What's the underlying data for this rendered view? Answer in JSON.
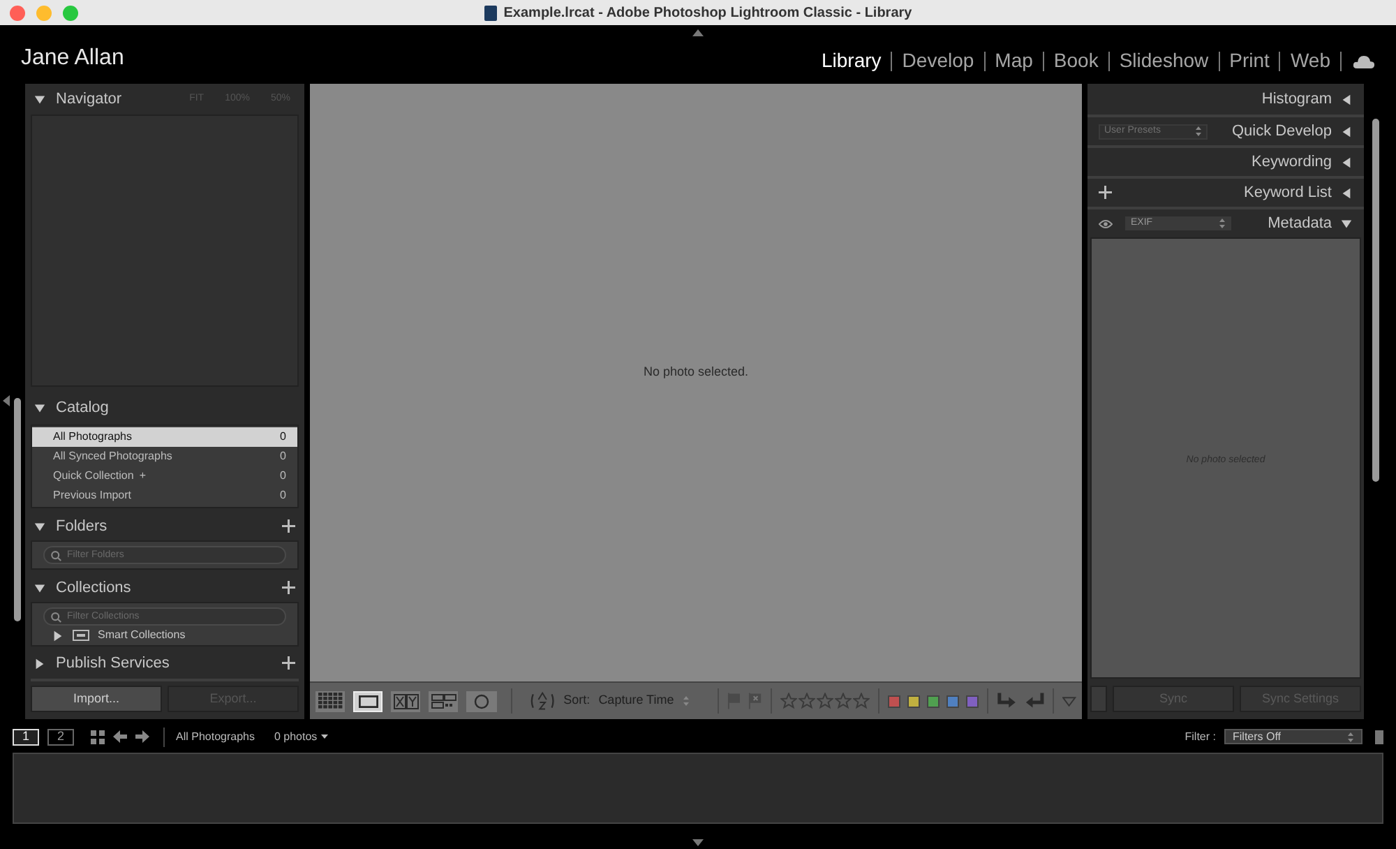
{
  "window": {
    "title": "Example.lrcat - Adobe Photoshop Lightroom Classic - Library"
  },
  "identity_plate": "Jane Allan",
  "modules": [
    {
      "label": "Library",
      "selected": true
    },
    {
      "label": "Develop",
      "selected": false
    },
    {
      "label": "Map",
      "selected": false
    },
    {
      "label": "Book",
      "selected": false
    },
    {
      "label": "Slideshow",
      "selected": false
    },
    {
      "label": "Print",
      "selected": false
    },
    {
      "label": "Web",
      "selected": false
    }
  ],
  "left_panel": {
    "navigator": {
      "title": "Navigator",
      "expanded": true,
      "zoom_options": [
        "FIT",
        "100%",
        "50%"
      ]
    },
    "catalog": {
      "title": "Catalog",
      "expanded": true,
      "items": [
        {
          "label": "All Photographs",
          "count": "0",
          "selected": true
        },
        {
          "label": "All Synced Photographs",
          "count": "0",
          "selected": false
        },
        {
          "label": "Quick Collection",
          "marker": "+",
          "count": "0",
          "selected": false
        },
        {
          "label": "Previous Import",
          "count": "0",
          "selected": false
        }
      ]
    },
    "folders": {
      "title": "Folders",
      "expanded": true,
      "placeholder": "Filter Folders"
    },
    "collections": {
      "title": "Collections",
      "expanded": true,
      "placeholder": "Filter Collections",
      "items": [
        {
          "label": "Smart Collections",
          "expanded": false
        }
      ]
    },
    "publish_services": {
      "title": "Publish Services",
      "expanded": false
    },
    "buttons": [
      {
        "label": "Import...",
        "disabled": false
      },
      {
        "label": "Export...",
        "disabled": true
      }
    ]
  },
  "center": {
    "message": "No photo selected.",
    "toolbar": {
      "view_modes": [
        {
          "kind": "grid",
          "selected": false
        },
        {
          "kind": "loupe",
          "selected": true
        },
        {
          "kind": "compare",
          "selected": false
        },
        {
          "kind": "survey",
          "selected": false
        },
        {
          "kind": "people",
          "selected": false
        }
      ],
      "sort_label": "Sort:",
      "sort_value": "Capture Time",
      "stars": 0,
      "color_labels": [
        {
          "color": "#c05050"
        },
        {
          "color": "#c0b040"
        },
        {
          "color": "#50a050"
        },
        {
          "color": "#5080c0"
        },
        {
          "color": "#8060c0"
        }
      ]
    }
  },
  "right_panel": {
    "panels": [
      {
        "kind": "plain",
        "title": "Histogram",
        "expanded": false
      },
      {
        "kind": "preset",
        "title": "Quick Develop",
        "expanded": false,
        "preset": "User Presets"
      },
      {
        "kind": "plain",
        "title": "Keywording",
        "expanded": false
      },
      {
        "kind": "add",
        "title": "Keyword List",
        "expanded": false
      },
      {
        "kind": "metadata",
        "title": "Metadata",
        "expanded": true,
        "preset": "EXIF"
      }
    ],
    "message": "No photo selected",
    "buttons": [
      {
        "label": "Sync",
        "disabled": true
      },
      {
        "label": "Sync Settings",
        "disabled": true
      }
    ]
  },
  "filmstrip_bar": {
    "screens": [
      {
        "label": "1",
        "selected": true
      },
      {
        "label": "2",
        "selected": false
      }
    ],
    "source": "All Photographs",
    "count": "0 photos",
    "filter_label": "Filter :",
    "filter_value": "Filters Off"
  }
}
